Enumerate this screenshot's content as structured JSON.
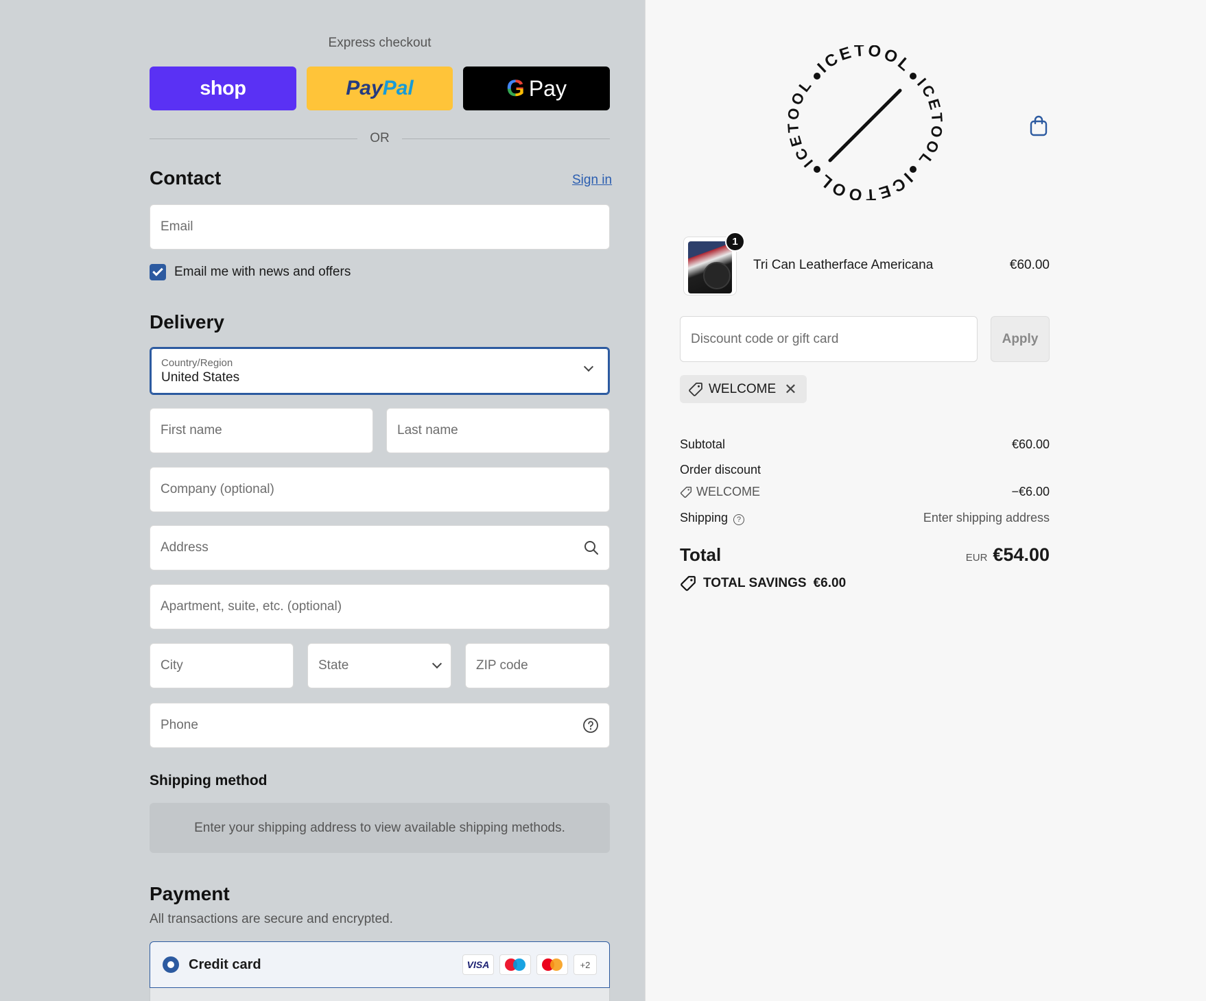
{
  "express": {
    "title": "Express checkout",
    "shop_label": "shop",
    "paypal_part1": "Pay",
    "paypal_part2": "Pal",
    "gpay_g": "G",
    "gpay_label": "Pay",
    "or_label": "OR"
  },
  "contact": {
    "heading": "Contact",
    "signin_label": "Sign in",
    "email_placeholder": "Email",
    "newsletter_label": "Email me with news and offers",
    "newsletter_checked": true
  },
  "delivery": {
    "heading": "Delivery",
    "country_label": "Country/Region",
    "country_value": "United States",
    "first_name_placeholder": "First name",
    "last_name_placeholder": "Last name",
    "company_placeholder": "Company (optional)",
    "address_placeholder": "Address",
    "apartment_placeholder": "Apartment, suite, etc. (optional)",
    "city_placeholder": "City",
    "state_placeholder": "State",
    "zip_placeholder": "ZIP code",
    "phone_placeholder": "Phone"
  },
  "shipping_method": {
    "heading": "Shipping method",
    "info": "Enter your shipping address to view available shipping methods."
  },
  "payment": {
    "heading": "Payment",
    "subtitle": "All transactions are secure and encrypted.",
    "credit_card_label": "Credit card",
    "card_logos": [
      "VISA",
      "maestro",
      "mastercard"
    ],
    "more_cards": "+2"
  },
  "brand": {
    "logo_text": "ICETOOL"
  },
  "order": {
    "item": {
      "name": "Tri Can Leatherface Americana",
      "price": "€60.00",
      "quantity": "1"
    },
    "discount_placeholder": "Discount code or gift card",
    "apply_label": "Apply",
    "applied_code": "WELCOME",
    "subtotal_label": "Subtotal",
    "subtotal_value": "€60.00",
    "order_discount_label": "Order discount",
    "discount_code": "WELCOME",
    "discount_value": "−€6.00",
    "shipping_label": "Shipping",
    "shipping_value": "Enter shipping address",
    "total_label": "Total",
    "currency": "EUR",
    "total_value": "€54.00",
    "savings_label": "TOTAL SAVINGS",
    "savings_value": "€6.00"
  },
  "colors": {
    "left_bg": "#cfd3d6",
    "right_bg": "#f7f7f7",
    "accent": "#2c5aa0",
    "shop_purple": "#5a31f4",
    "paypal_yellow": "#ffc439"
  }
}
